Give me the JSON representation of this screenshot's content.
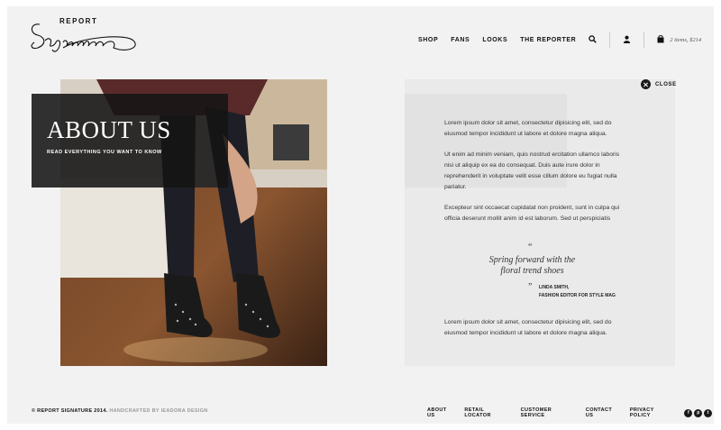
{
  "logo": {
    "report": "REPORT",
    "script": "Signature"
  },
  "nav": {
    "items": [
      "SHOP",
      "FANS",
      "LOOKS",
      "THE REPORTER"
    ],
    "cart": "2 items, $214"
  },
  "hero": {
    "title": "ABOUT US",
    "subtitle": "READ EVERYTHING YOU WANT TO KNOW"
  },
  "close_label": "CLOSE",
  "paragraphs": [
    "Lorem ipsum dolor sit amet, consectetur  dipisicing elit, sed do eiusmod tempor incididunt ut labore et dolore magna aliqua.",
    "Ut enim ad minim veniam, quis nostrud  ercitation ullamco laboris nisi ut aliquip ex ea do consequat. Duis aute irure dolor in reprehenderit in voluptate velit esse cillum dolore eu fugiat nulla pariatur.",
    "Excepteur sint occaecat cupidatat non proident, sunt in culpa qui officia deserunt mollit anim id est laborum. Sed ut perspiciatis"
  ],
  "quote": {
    "open": "“",
    "text": "Spring forward with the floral trend shoes",
    "close": "”",
    "author_name": "LINDA SMITH,",
    "author_title": "FASHION EDITOR FOR STYLE MAG"
  },
  "paragraph_last": "Lorem ipsum dolor sit amet, consectetur  dipisicing elit, sed do eiusmod tempor incididunt ut labore et dolore magna aliqua.",
  "footer": {
    "copyright": "© REPORT SIGNATURE 2014.",
    "credit": "HANDCRAFTED BY IEADORA DESIGN",
    "links": [
      "ABOUT US",
      "RETAIL LOCATOR",
      "CUSTOMER SERVICE",
      "CONTACT US",
      "PRIVACY POLICY"
    ],
    "social": [
      {
        "icon": "facebook-icon",
        "glyph": "f"
      },
      {
        "icon": "pinterest-icon",
        "glyph": "p"
      },
      {
        "icon": "twitter-icon",
        "glyph": "t"
      }
    ]
  },
  "icons": {
    "search": "search-icon",
    "user": "user-icon",
    "bag": "shopping-bag-icon",
    "close": "close-icon"
  }
}
